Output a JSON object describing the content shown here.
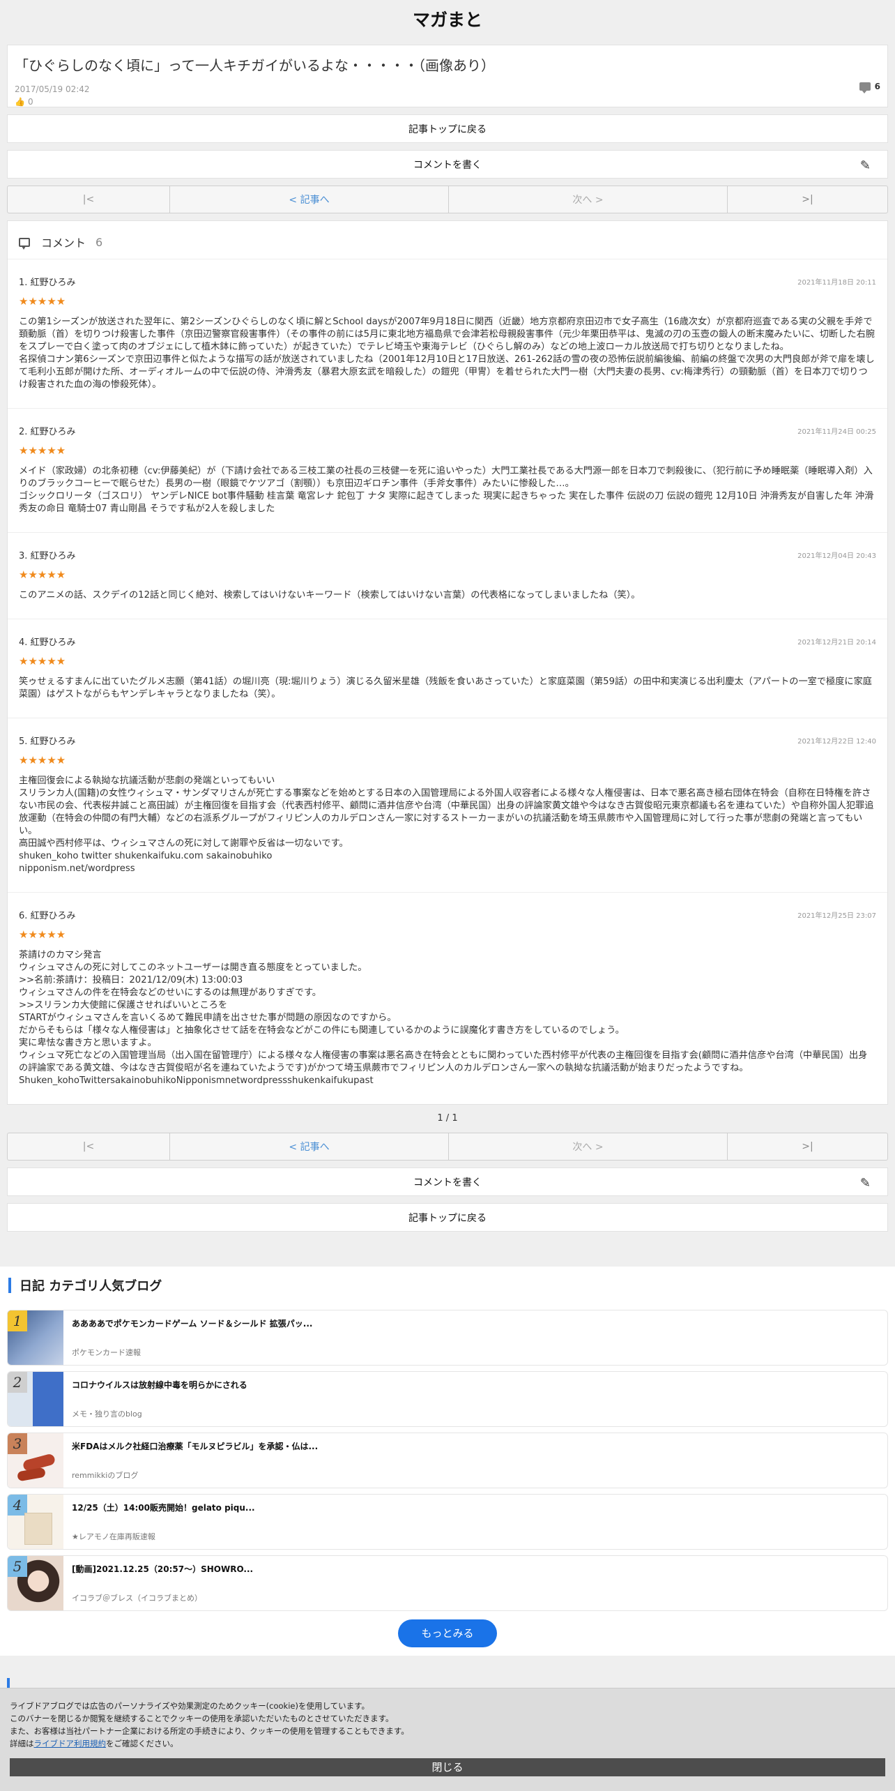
{
  "site_title": "マガまと",
  "article": {
    "title": "「ひぐらしのなく頃に」って一人キチガイがいるよな・・・・・（画像あり）",
    "date": "2017/05/19 02:42",
    "likes": "0",
    "comment_count": "6"
  },
  "buttons": {
    "back_to_top": "記事トップに戻る",
    "write_comment": "コメントを書く"
  },
  "pager": {
    "first": "|<",
    "prev": "< 記事へ",
    "next": "次へ >",
    "last": ">|",
    "page": "1 / 1"
  },
  "comments_header": {
    "label": "コメント",
    "count": "6"
  },
  "comments": [
    {
      "name": "1. 紅野ひろみ",
      "date": "2021年11月18日 20:11",
      "stars": "★★★★★",
      "body": "この第1シーズンが放送された翌年に、第2シーズンひぐらしのなく頃に解とSchool daysが2007年9月18日に関西（近畿）地方京都府京田辺市で女子高生（16歳次女）が京都府巡査である実の父親を手斧で頚動脈（首）を切りつけ殺害した事件（京田辺警察官殺害事件）（その事件の前には5月に東北地方福島県で会津若松母親殺害事件（元少年栗田恭平は、鬼滅の刃の玉壺の鍛人の断末魔みたいに、切断した右腕をスプレーで白く塗って肉のオブジェにして植木鉢に飾っていた）が起きていた）でテレビ埼玉や東海テレビ（ひぐらし解のみ）などの地上波ローカル放送局で打ち切りとなりましたね。\n名探偵コナン第6シーズンで京田辺事件と似たような描写の話が放送されていましたね（2001年12月10日と17日放送、261-262話の雪の夜の恐怖伝説前編後編、前編の終盤で次男の大門良郎が斧で扉を壊して毛利小五郎が開けた所、オーディオルームの中で伝説の侍、沖滑秀友（暴君大原玄武を暗殺した）の鎧兜（甲冑）を着せられた大門一樹（大門夫妻の長男、cv:梅津秀行）の頸動脈（首）を日本刀で切りつけ殺害された血の海の惨殺死体）。"
    },
    {
      "name": "2. 紅野ひろみ",
      "date": "2021年11月24日 00:25",
      "stars": "★★★★★",
      "body": "メイド（家政婦）の北条初穂（cv:伊藤美紀）が（下請け会社である三枝工業の社長の三枝健一を死に追いやった）大門工業社長である大門源一郎を日本刀で刺殺後に、（犯行前に予め睡眠薬（睡眠導入剤）入りのブラックコーヒーで眠らせた）長男の一樹（眼鏡でケツアゴ（割顎））も京田辺ギロチン事件（手斧女事件）みたいに惨殺した…。\nゴシックロリータ（ゴスロリ） ヤンデレNICE bot事件騒動 桂言葉 竜宮レナ 鉈包丁 ナタ 実際に起きてしまった 現実に起きちゃった 実在した事件 伝説の刀 伝説の鎧兜 12月10日 沖滑秀友が自害した年 沖滑秀友の命日 竜騎士07 青山剛昌 そうです私が2人を殺しました"
    },
    {
      "name": "3. 紅野ひろみ",
      "date": "2021年12月04日 20:43",
      "stars": "★★★★★",
      "body": "このアニメの話、スクデイの12話と同じく絶対、検索してはいけないキーワード（検索してはいけない言葉）の代表格になってしまいましたね（笑）。"
    },
    {
      "name": "4. 紅野ひろみ",
      "date": "2021年12月21日 20:14",
      "stars": "★★★★★",
      "body": "笑ゥせぇるすまんに出ていたグルメ志願（第41話）の堀川亮（現:堀川りょう）演じる久留米星雄（残飯を食いあさっていた）と家庭菜園（第59話）の田中和実演じる出利慶太（アパートの一室で極度に家庭菜園）はゲストながらもヤンデレキャラとなりましたね（笑）。"
    },
    {
      "name": "5. 紅野ひろみ",
      "date": "2021年12月22日 12:40",
      "stars": "★★★★★",
      "body": "主権回復会による執拗な抗議活動が悲劇の発端といってもいい\nスリランカ人(国籍)の女性ウィシュマ・サンダマリさんが死亡する事案などを始めとする日本の入国管理局による外国人収容者による様々な人権侵害は、日本で悪名高き極右団体在特会（自称在日特権を許さない市民の会、代表桜井誠こと高田誠）が主権回復を目指す会（代表西村修平、顧問に酒井信彦や台湾（中華民国）出身の評論家黄文雄や今はなき古賀俊昭元東京都議も名を連ねていた）や自称外国人犯罪追放運動（在特会の仲間の有門大輔）などの右派系グループがフィリピン人のカルデロンさん一家に対するストーカーまがいの抗議活動を埼玉県蕨市や入国管理局に対して行った事が悲劇の発端と言ってもいい。\n高田誠や西村修平は、ウィシュマさんの死に対して謝罪や反省は一切ないです。\nshuken_koho twitter shukenkaifuku.com sakainobuhiko\nnipponism.net/wordpress"
    },
    {
      "name": "6. 紅野ひろみ",
      "date": "2021年12月25日 23:07",
      "stars": "★★★★★",
      "body": "茶請けのカマシ発言\nウィシュマさんの死に対してこのネットユーザーは開き直る態度をとっていました。\n>>名前:茶請け：投稿日：2021/12/09(木) 13:00:03\nウィシュマさんの件を在特会などのせいにするのは無理がありすぎです。\n>>スリランカ大使館に保護させればいいところを\nSTARTがウィシュマさんを言いくるめて難民申請を出させた事が問題の原因なのですから。\nだからそもらは「様々な人権侵害は」と抽象化させて話を在特会などがこの件にも関連しているかのように誤魔化す書き方をしているのでしょう。\n実に卑怯な書き方と思いますよ。\nウィシュマ死亡などの入国管理当局（出入国在留管理庁）による様々な人権侵害の事案は悪名高き在特会とともに関わっていた西村修平が代表の主権回復を目指す会(顧問に酒井信彦や台湾（中華民国）出身の評論家である黄文雄、今はなき古賀俊昭が名を連ねていたようです)がかつて埼玉県蕨市でフィリピン人のカルデロンさん一家への執拗な抗議活動が始まりだったようですね。\nShuken_kohoTwittersakainobuhikoNipponismnetwordpressshukenkaifukupast"
    }
  ],
  "ranking": {
    "title": "日記 カテゴリ人気ブログ",
    "items": [
      {
        "rank": "1",
        "headline": "ああああでポケモンカードゲーム ソード＆シールド 拡張パッ...",
        "blog": "ポケモンカード速報",
        "badge_color": "#f3c431",
        "thumb_color": "#6d87b3"
      },
      {
        "rank": "2",
        "headline": "コロナウイルスは放射線中毒を明らかにされる",
        "blog": "メモ・独り言のblog",
        "badge_color": "#cfcfcf",
        "thumb_color": "#5a8ad8"
      },
      {
        "rank": "3",
        "headline": "米FDAはメルク社経口治療薬「モルヌピラビル」を承認・仏は...",
        "blog": "remmikkiのブログ",
        "badge_color": "#c9825a",
        "thumb_color": "#f4e9e4"
      },
      {
        "rank": "4",
        "headline": "12/25（土）14:00販売開始！gelato piqu...",
        "blog": "★レアモノ在庫再販速報",
        "badge_color": "#7bbbe6",
        "thumb_color": "#efe6d6"
      },
      {
        "rank": "5",
        "headline": "[動画]2021.12.25（20:57～）SHOWRO...",
        "blog": "イコラブ＠ブレス（イコラブまとめ）",
        "badge_color": "#7bbbe6",
        "thumb_color": "#e8d8cc"
      }
    ],
    "more": "もっとみる"
  },
  "cookie": {
    "line1": "ライブドアブログでは広告のパーソナライズや効果測定のためクッキー(cookie)を使用しています。",
    "line2": "このバナーを閉じるか閲覧を継続することでクッキーの使用を承認いただいたものとさせていただきます。",
    "line3": "また、お客様は当社パートナー企業における所定の手続きにより、クッキーの使用を管理することもできます。",
    "line4_pre": "詳細は",
    "line4_link": "ライブドア利用規約",
    "line4_post": "をご確認ください。",
    "close": "閉じる"
  }
}
